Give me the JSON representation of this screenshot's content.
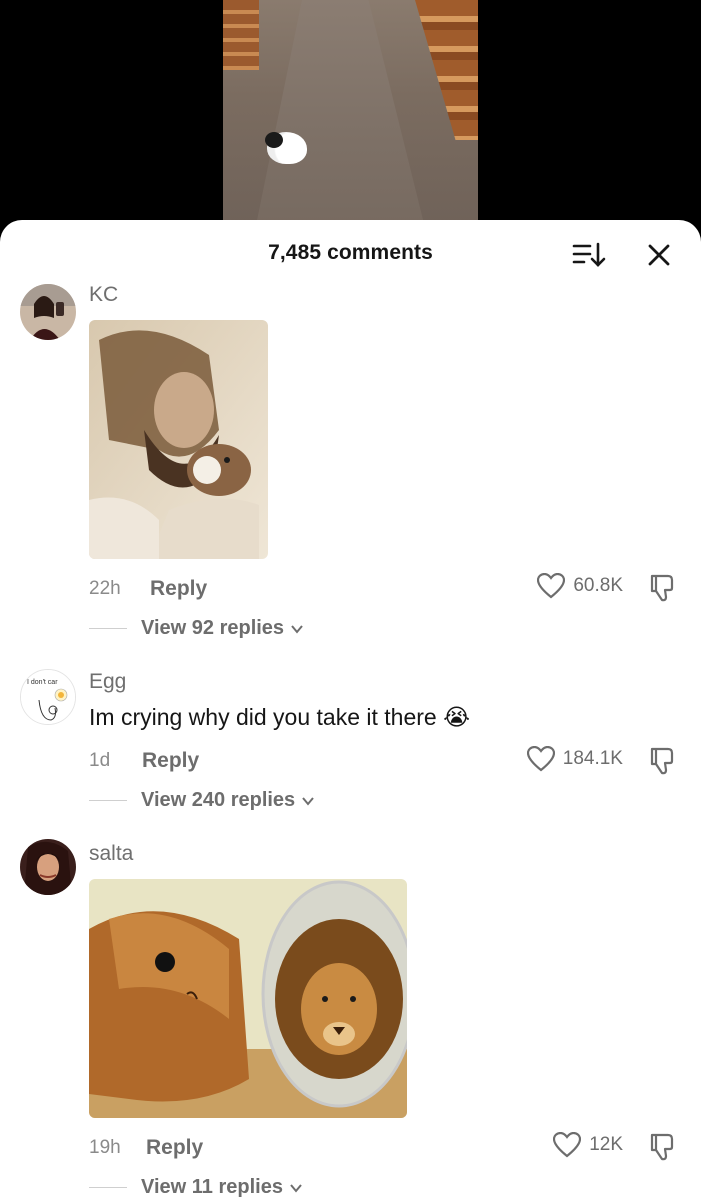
{
  "header": {
    "comment_count": "7,485 comments"
  },
  "comments": [
    {
      "username": "KC",
      "text": "",
      "has_image": true,
      "time": "22h",
      "reply_label": "Reply",
      "likes": "60.8K",
      "view_replies": "View 92 replies"
    },
    {
      "username": "Egg",
      "text": "Im crying why did you take it there 😭",
      "avatar_caption": "I don't car",
      "has_image": false,
      "time": "1d",
      "reply_label": "Reply",
      "likes": "184.1K",
      "view_replies": "View 240 replies"
    },
    {
      "username": "salta",
      "text": "",
      "has_image": true,
      "time": "19h",
      "reply_label": "Reply",
      "likes": "12K",
      "view_replies": "View 11 replies"
    }
  ],
  "icons": [
    "sort-icon",
    "close-icon",
    "heart-icon",
    "dislike-icon",
    "chevron-down-icon"
  ]
}
